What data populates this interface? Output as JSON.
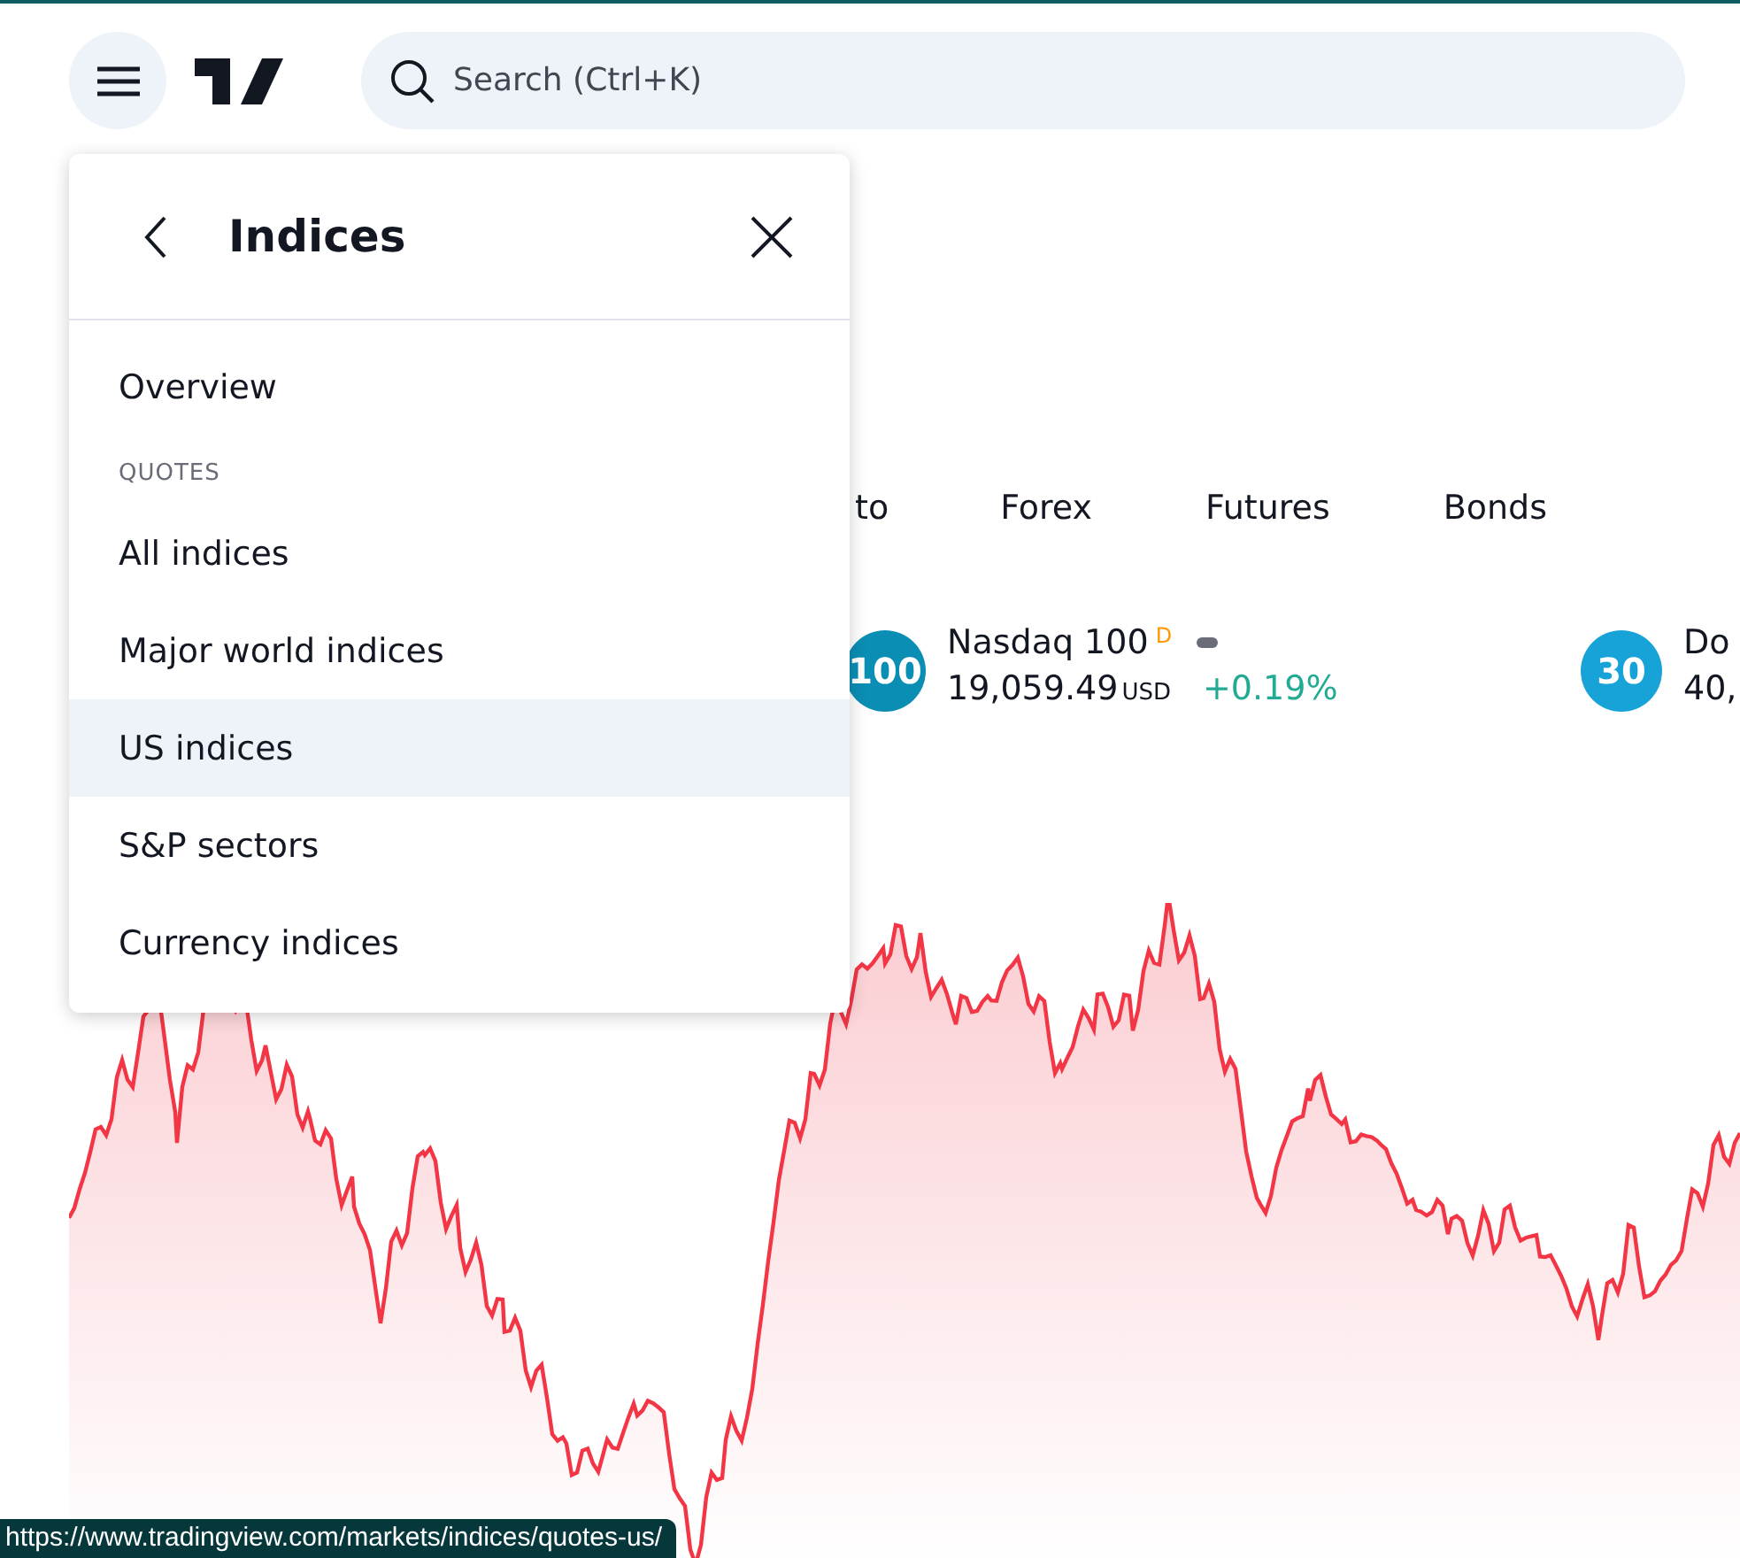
{
  "header": {
    "search": {
      "placeholder": "Search (Ctrl+K)"
    }
  },
  "tabs": [
    {
      "label": "to"
    },
    {
      "label": "Forex"
    },
    {
      "label": "Futures"
    },
    {
      "label": "Bonds"
    }
  ],
  "quotes": [
    {
      "badge": "100",
      "name": "Nasdaq 100",
      "flag": "D",
      "price": "19,059.49",
      "currency": "USD",
      "change": "+0.19%",
      "color": "#0b8eb4"
    },
    {
      "badge": "30",
      "name": "Do",
      "price": "40,",
      "color": "#17a3d8"
    }
  ],
  "menu": {
    "title": "Indices",
    "overview": {
      "label": "Overview",
      "selected": false
    },
    "section": {
      "heading": "QUOTES",
      "items": [
        {
          "label": "All indices",
          "selected": false
        },
        {
          "label": "Major world indices",
          "selected": false
        },
        {
          "label": "US indices",
          "selected": true
        },
        {
          "label": "S&P sectors",
          "selected": false
        },
        {
          "label": "Currency indices",
          "selected": false
        }
      ]
    }
  },
  "status_bar": {
    "url": "https://www.tradingview.com/markets/indices/quotes-us/"
  }
}
